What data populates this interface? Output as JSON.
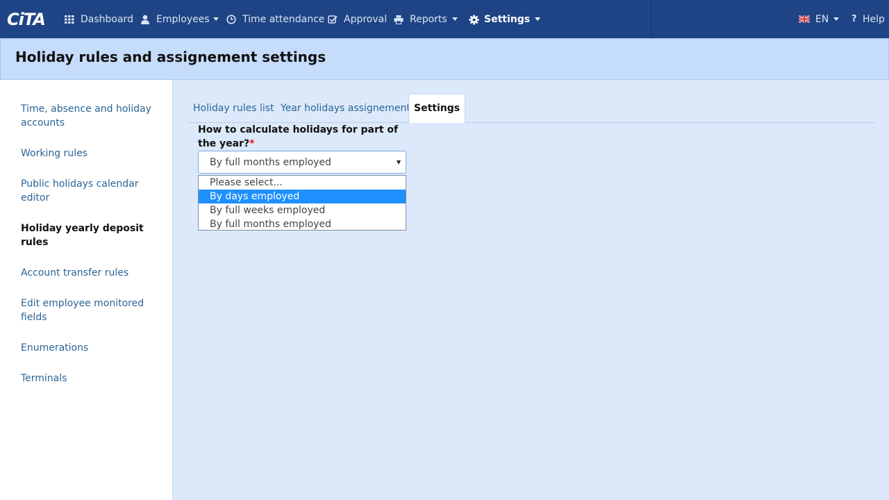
{
  "app": {
    "logo_text": "CiTA"
  },
  "nav": {
    "dashboard": "Dashboard",
    "employees": "Employees",
    "time_attendance": "Time attendance",
    "approval": "Approval",
    "reports": "Reports",
    "settings": "Settings",
    "language": "EN",
    "help": "Help"
  },
  "header": {
    "title": "Holiday rules and assignement settings"
  },
  "sidebar": {
    "items": [
      {
        "label": "Time, absence and holiday accounts"
      },
      {
        "label": "Working rules"
      },
      {
        "label": "Public holidays calendar editor"
      },
      {
        "label": "Holiday yearly deposit rules"
      },
      {
        "label": "Account transfer rules"
      },
      {
        "label": "Edit employee monitored fields"
      },
      {
        "label": "Enumerations"
      },
      {
        "label": "Terminals"
      }
    ]
  },
  "tabs": [
    {
      "label": "Holiday rules list"
    },
    {
      "label": "Year holidays assignement"
    },
    {
      "label": "Settings"
    }
  ],
  "form": {
    "question": "How to calculate holidays for part of the year?",
    "required_mark": "*",
    "selected_value": "By full months employed",
    "options": [
      "Please select...",
      "By days employed",
      "By full weeks employed",
      "By full months employed"
    ]
  },
  "colors": {
    "nav_bg": "#1e4485",
    "accent": "#1e90ff",
    "link": "#2a6496"
  },
  "icons": [
    "grid-icon",
    "user-icon",
    "clock-icon",
    "check-icon",
    "printer-icon",
    "gear-icon",
    "flag-icon",
    "question-icon"
  ]
}
